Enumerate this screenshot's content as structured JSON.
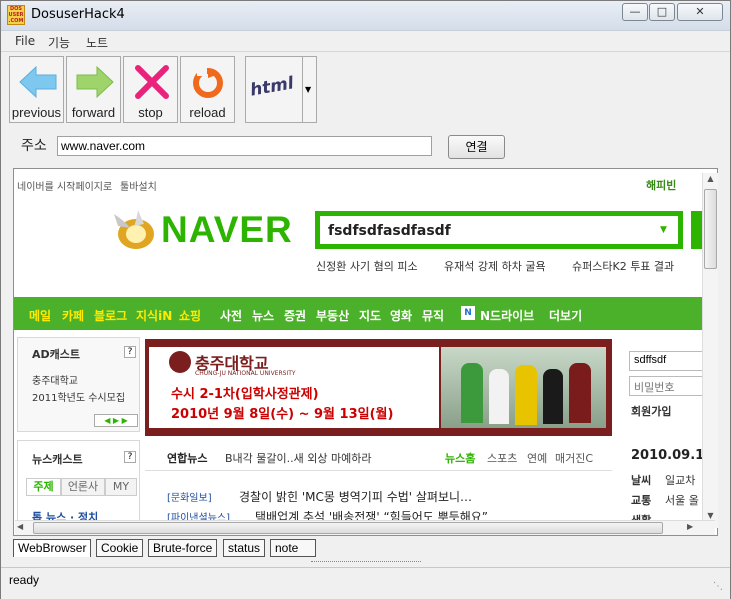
{
  "window": {
    "title": "DosuserHack4",
    "icon_text": "DOS USER .COM"
  },
  "menu": [
    "File",
    "기능",
    "노트"
  ],
  "toolbar": {
    "previous": "previous",
    "forward": "forward",
    "stop": "stop",
    "reload": "reload",
    "html": "html"
  },
  "address": {
    "label": "주소",
    "value": "www.naver.com",
    "go": "연결"
  },
  "naver": {
    "top_left": [
      "네이버를 시작페이지로",
      "툴바설치"
    ],
    "top_right": [
      "해피빈"
    ],
    "logo": "NAVER",
    "search_value": "fsdfsdfasdfasdf",
    "keywords": [
      "신정환 사기 혐의 피소",
      "유재석 강제 하차 굴욕",
      "슈퍼스타K2 투표 결과"
    ],
    "nav": [
      "메일",
      "카페",
      "블로그",
      "지식iN",
      "쇼핑",
      "사전",
      "뉴스",
      "증권",
      "부동산",
      "지도",
      "영화",
      "뮤직",
      "N드라이브",
      "더보기"
    ],
    "adcast": {
      "title": "AD캐스트",
      "help": "?",
      "line1": "충주대학교",
      "line2": "2011학년도 수시모집"
    },
    "banner": {
      "univ": "충주대학교",
      "univ_en": "CHUNG-JU NATIONAL UNIVERSITY",
      "line1": "수시 2-1차(입학사정관제)",
      "line2": "2010년 9월 8일(수) ~ 9월 13일(월)"
    },
    "login": {
      "id": "sdffsdf",
      "pw": "비밀번호",
      "join": "회원가입"
    },
    "newscast": {
      "title": "뉴스캐스트",
      "help": "?",
      "tabs": [
        "주제",
        "언론사",
        "MY"
      ],
      "cut": "톱 뉴스 · 정치"
    },
    "yonhap": {
      "label": "연합뉴스",
      "headline": "B내각 물갈이..새 외상 마예하라",
      "home": "뉴스홈",
      "sports": "스포츠",
      "ent": "연예",
      "mag": "매거진C"
    },
    "news": [
      {
        "src": "[문화일보]",
        "title": "경찰이 밝힌 'MC몽 병역기피 수법' 살펴보니…"
      },
      {
        "src": "[파이낸셜뉴스]",
        "title": "택배업계 추석 '배송전쟁' “힘들어도 뿌듯해요”"
      }
    ],
    "right": {
      "date": "2010.09.1",
      "weather": "날씨",
      "weather_v": "일교차",
      "traffic": "교통",
      "traffic_v": "서울 올",
      "life": "생활"
    }
  },
  "tabs": [
    "WebBrowser",
    "Cookie",
    "Brute-force",
    "status",
    "note"
  ],
  "status": "ready"
}
